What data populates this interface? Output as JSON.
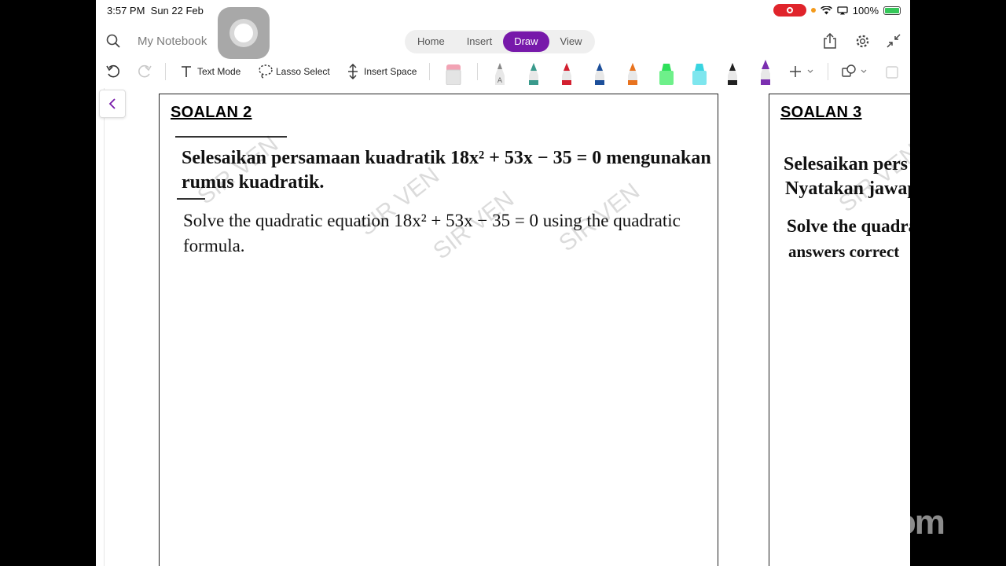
{
  "status_bar": {
    "time": "3:57 PM",
    "date": "Sun 22 Feb",
    "battery": "100%"
  },
  "title_bar": {
    "notebook_name": "My Notebook",
    "tabs": [
      {
        "label": "Home",
        "active": false
      },
      {
        "label": "Insert",
        "active": false
      },
      {
        "label": "Draw",
        "active": true
      },
      {
        "label": "View",
        "active": false
      }
    ]
  },
  "toolbar": {
    "text_mode": "Text Mode",
    "lasso_select": "Lasso Select",
    "insert_space": "Insert Space",
    "pens": [
      {
        "name": "highlighter-pink",
        "color": "#f2a7b7"
      },
      {
        "name": "pencil-gray",
        "color": "#8a8a8a"
      },
      {
        "name": "pen-teal",
        "color": "#3a9a8c"
      },
      {
        "name": "pen-red",
        "color": "#d32030"
      },
      {
        "name": "pen-blue",
        "color": "#1d4f9a"
      },
      {
        "name": "pen-orange",
        "color": "#e8731f"
      },
      {
        "name": "highlighter-green",
        "color": "#2ee05a"
      },
      {
        "name": "highlighter-cyan",
        "color": "#39d4e0"
      },
      {
        "name": "pen-black",
        "color": "#222222"
      },
      {
        "name": "pen-purple",
        "color": "#7b2fb0"
      }
    ]
  },
  "pages": [
    {
      "heading": "SOALAN 2",
      "malay_line1": "Selesaikan persamaan kuadratik 18x² + 53x − 35 = 0 mengunakan",
      "malay_line2": "rumus kuadratik.",
      "english_line1": "Solve the quadratic equation 18x² + 53x − 35 = 0 using the quadratic",
      "english_line2": "formula."
    },
    {
      "heading": "SOALAN 3",
      "malay_line1": "Selesaikan pers",
      "malay_line2": "Nyatakan jawap",
      "english_line1": "Solve the quadra",
      "english_line2": "answers correct"
    }
  ],
  "watermark": "SIR VEN",
  "overlay": "zoom"
}
